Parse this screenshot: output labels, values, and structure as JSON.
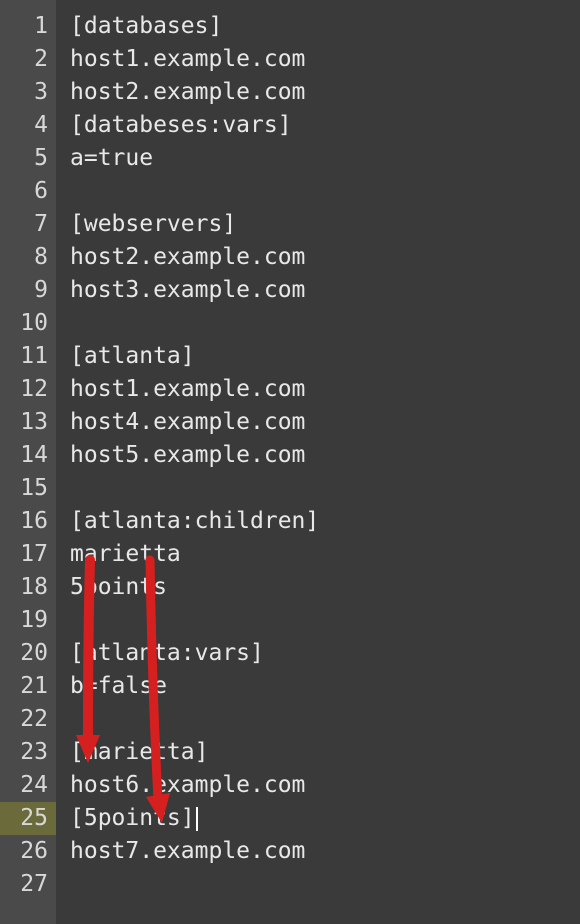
{
  "lines": [
    {
      "num": 1,
      "text": "[databases]"
    },
    {
      "num": 2,
      "text": "host1.example.com"
    },
    {
      "num": 3,
      "text": "host2.example.com"
    },
    {
      "num": 4,
      "text": "[databeses:vars]"
    },
    {
      "num": 5,
      "text": "a=true"
    },
    {
      "num": 6,
      "text": ""
    },
    {
      "num": 7,
      "text": "[webservers]"
    },
    {
      "num": 8,
      "text": "host2.example.com"
    },
    {
      "num": 9,
      "text": "host3.example.com"
    },
    {
      "num": 10,
      "text": ""
    },
    {
      "num": 11,
      "text": "[atlanta]"
    },
    {
      "num": 12,
      "text": "host1.example.com"
    },
    {
      "num": 13,
      "text": "host4.example.com"
    },
    {
      "num": 14,
      "text": "host5.example.com"
    },
    {
      "num": 15,
      "text": ""
    },
    {
      "num": 16,
      "text": "[atlanta:children]"
    },
    {
      "num": 17,
      "text": "marietta"
    },
    {
      "num": 18,
      "text": "5points"
    },
    {
      "num": 19,
      "text": ""
    },
    {
      "num": 20,
      "text": "[atlanta:vars]"
    },
    {
      "num": 21,
      "text": "b=false"
    },
    {
      "num": 22,
      "text": ""
    },
    {
      "num": 23,
      "text": "[marietta]"
    },
    {
      "num": 24,
      "text": "host6.example.com"
    },
    {
      "num": 25,
      "text": "[5points]",
      "highlighted": true,
      "cursor": true
    },
    {
      "num": 26,
      "text": "host7.example.com"
    },
    {
      "num": 27,
      "text": ""
    }
  ]
}
